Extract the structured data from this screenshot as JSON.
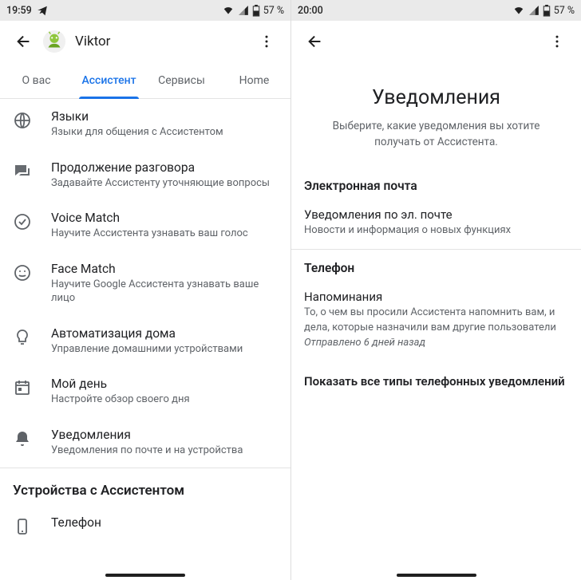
{
  "left": {
    "statusbar": {
      "time": "19:59",
      "battery": "57 %"
    },
    "header": {
      "name": "Viktor"
    },
    "tabs": [
      {
        "label": "О вас",
        "active": false
      },
      {
        "label": "Ассистент",
        "active": true
      },
      {
        "label": "Сервисы",
        "active": false
      },
      {
        "label": "Home",
        "active": false
      }
    ],
    "items": [
      {
        "icon": "globe",
        "title": "Языки",
        "sub": "Языки для общения с Ассистентом"
      },
      {
        "icon": "chat",
        "title": "Продолжение разговора",
        "sub": "Задавайте Ассистенту уточняющие вопросы"
      },
      {
        "icon": "check-circle",
        "title": "Voice Match",
        "sub": "Научите Ассистента узнавать ваш голос"
      },
      {
        "icon": "face",
        "title": "Face Match",
        "sub": "Научите Google Ассистента узнавать ваше лицо"
      },
      {
        "icon": "lightbulb",
        "title": "Автоматизация дома",
        "sub": "Управление домашними устройствами"
      },
      {
        "icon": "calendar",
        "title": "Мой день",
        "sub": "Настройте обзор своего дня"
      },
      {
        "icon": "bell",
        "title": "Уведомления",
        "sub": "Уведомления по почте и на устройства"
      }
    ],
    "devices_section": "Устройства с Ассистентом",
    "device_phone": "Телефон"
  },
  "right": {
    "statusbar": {
      "time": "20:00",
      "battery": "57 %"
    },
    "title": "Уведомления",
    "desc": "Выберите, какие уведомления вы хотите получать от Ассистента.",
    "sections": [
      {
        "title": "Электронная почта",
        "items": [
          {
            "title": "Уведомления по эл. почте",
            "sub": "Новости и информация о новых функциях"
          }
        ]
      },
      {
        "title": "Телефон",
        "items": [
          {
            "title": "Напоминания",
            "sub": "То, о чем вы просили Ассистента напомнить вам, и дела, которые назначили вам другие пользователи",
            "note": "Отправлено 6 дней назад"
          }
        ]
      }
    ],
    "show_all": "Показать все типы телефонных уведомлений"
  }
}
